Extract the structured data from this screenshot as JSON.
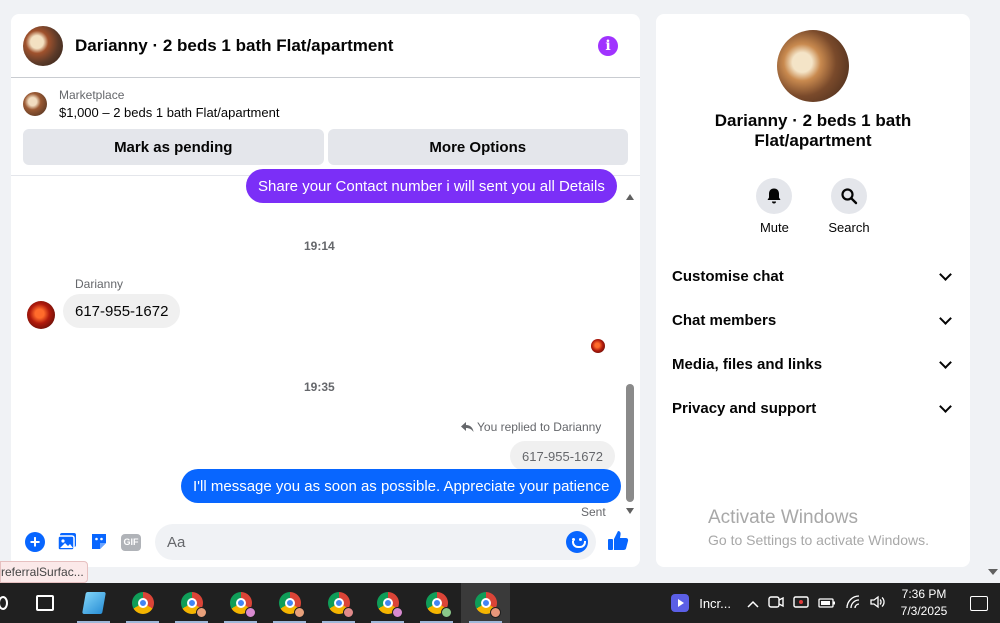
{
  "chat": {
    "title": "Darianny · 2 beds 1 bath Flat/apartment",
    "listing": {
      "category": "Marketplace",
      "price_title": "$1,000 – 2 beds 1 bath Flat/apartment",
      "mark_pending": "Mark as pending",
      "more_options": "More Options"
    },
    "messages": {
      "msg1": "Share your Contact number i will sent you all Details",
      "time1": "19:14",
      "sender": "Darianny",
      "msg2": "617-955-1672",
      "time2": "19:35",
      "replied_note": "You replied to Darianny",
      "quoted": "617-955-1672",
      "msg3": "I'll message you as soon as possible. Appreciate your patience",
      "status": "Sent"
    },
    "composer": {
      "placeholder": "Aa",
      "gif_label": "GIF"
    }
  },
  "tooltip": "referralSurfac...",
  "right_panel": {
    "title": "Darianny · 2 beds 1 bath Flat/apartment",
    "mute": "Mute",
    "search": "Search",
    "sections": [
      "Customise chat",
      "Chat members",
      "Media, files and links",
      "Privacy and support"
    ]
  },
  "watermark": {
    "line1": "Activate Windows",
    "line2": "Go to Settings to activate Windows."
  },
  "taskbar": {
    "app_label": "Incr...",
    "time": "7:36 PM",
    "date": "7/3/2025"
  },
  "colors": {
    "messenger_blue": "#0866ff",
    "purple_bubble": "#7b2ff7",
    "info_purple": "#a033ff"
  }
}
